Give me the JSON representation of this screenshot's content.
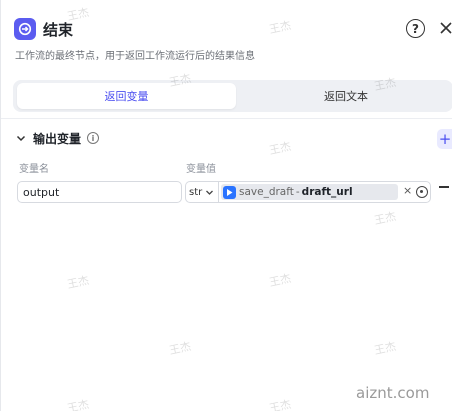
{
  "header": {
    "title": "结束",
    "description": "工作流的最终节点，用于返回工作流运行后的结果信息",
    "help_label": "?"
  },
  "tabs": [
    {
      "label": "返回变量",
      "active": true
    },
    {
      "label": "返回文本",
      "active": false
    }
  ],
  "output_section": {
    "title": "输出变量",
    "info_label": "i",
    "add_label": "+",
    "columns": {
      "name": "变量名",
      "value": "变量值"
    },
    "rows": [
      {
        "name": "output",
        "type": "str",
        "ref_node": "save_draft",
        "ref_separator": "-",
        "ref_field": "draft_url",
        "clear_label": "×"
      }
    ]
  },
  "watermarks": [
    "王杰",
    "王杰",
    "王杰",
    "王杰",
    "王杰",
    "王杰",
    "王杰",
    "王杰",
    "王杰",
    "王杰",
    "王杰",
    "王杰"
  ],
  "footer": {
    "site": "aiznt.com"
  },
  "colors": {
    "accent": "#4b4ef0",
    "node_icon": "#5b5cf0",
    "plugin_icon": "#2a73ff"
  }
}
